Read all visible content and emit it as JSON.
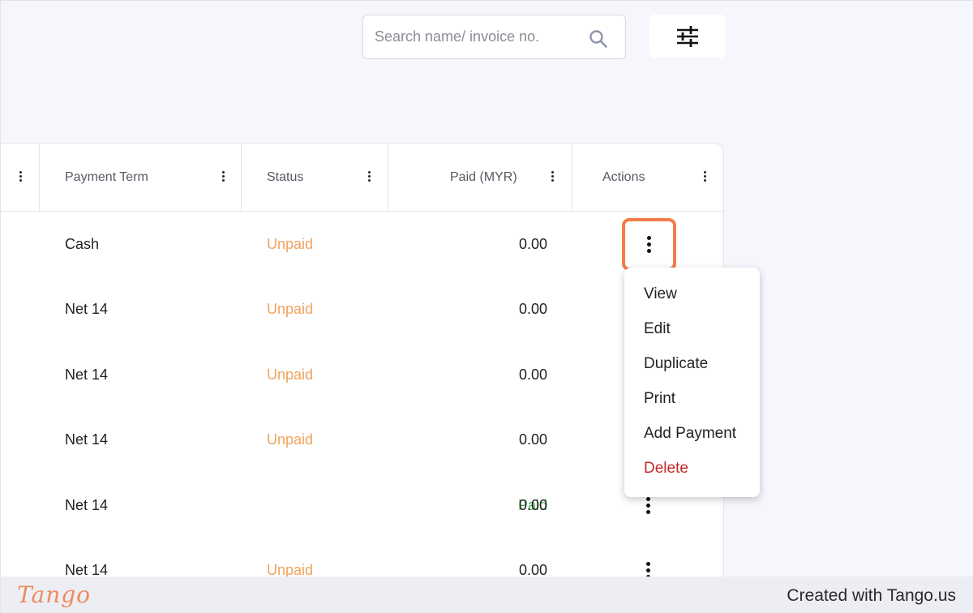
{
  "search": {
    "placeholder": "Search name/ invoice no."
  },
  "icons": {
    "search": "search-icon",
    "filter": "sliders-icon",
    "column_menu": "kebab-icon",
    "row_actions": "kebab-icon"
  },
  "table": {
    "columns": [
      {
        "label": ""
      },
      {
        "label": "Payment Term"
      },
      {
        "label": "Status"
      },
      {
        "label": "Paid (MYR)"
      },
      {
        "label": "Actions"
      }
    ],
    "rows": [
      {
        "term": "Cash",
        "status": "Unpaid",
        "paid": "0.00"
      },
      {
        "term": "Net 14",
        "status": "Unpaid",
        "paid": "0.00"
      },
      {
        "term": "Net 14",
        "status": "Unpaid",
        "paid": "0.00"
      },
      {
        "term": "Net 14",
        "status": "Unpaid",
        "paid": "0.00"
      },
      {
        "term": "Net 14",
        "status": "Paid",
        "paid": "0.00"
      },
      {
        "term": "Net 14",
        "status": "Unpaid",
        "paid": "0.00"
      }
    ]
  },
  "action_menu": {
    "items": [
      "View",
      "Edit",
      "Duplicate",
      "Print",
      "Add Payment",
      "Delete"
    ]
  },
  "colors": {
    "unpaid": "#f0a35d",
    "paid": "#4caf50",
    "delete": "#c62828",
    "highlight": "#f47c48"
  },
  "footer": {
    "logo": "Tango",
    "credit": "Created with Tango.us"
  }
}
